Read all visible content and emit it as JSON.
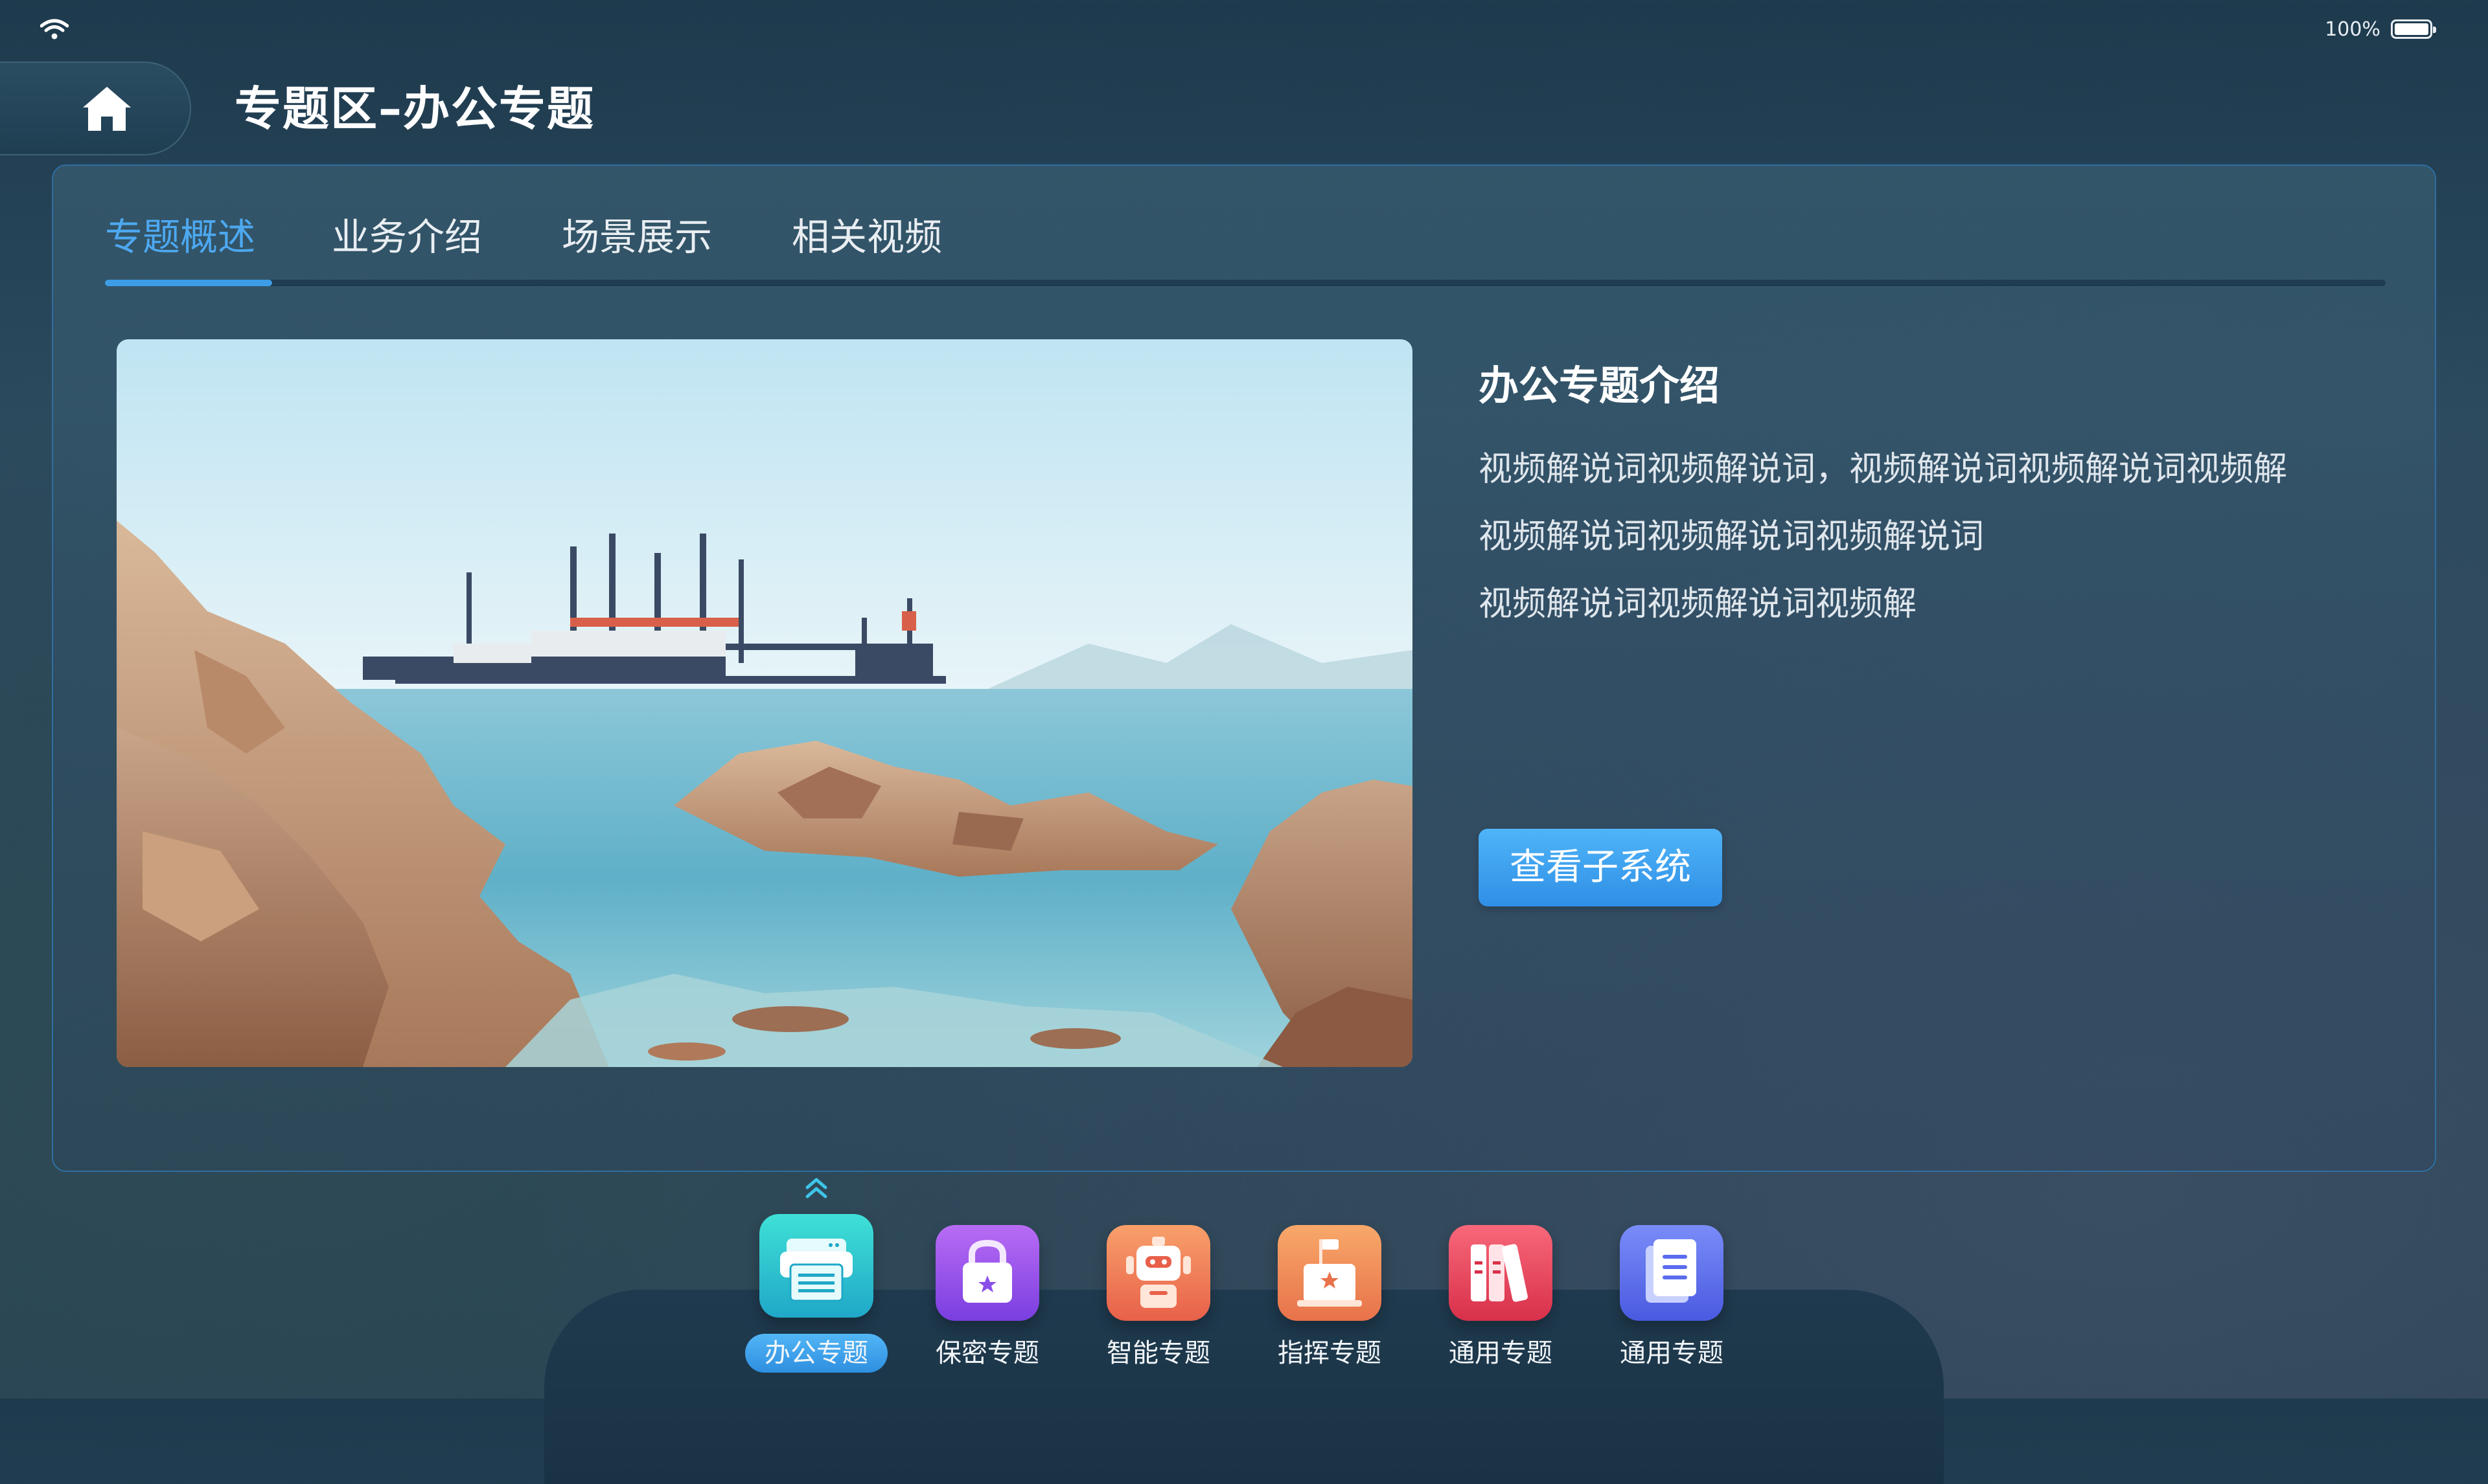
{
  "status_bar": {
    "battery": "100%",
    "wifi_icon": "wifi-icon",
    "battery_icon": "battery-icon"
  },
  "header": {
    "title": "专题区–办公专题",
    "home_icon": "home-icon"
  },
  "tabs": [
    {
      "label": "专题概述",
      "active": true
    },
    {
      "label": "业务介绍",
      "active": false
    },
    {
      "label": "场景展示",
      "active": false
    },
    {
      "label": "相关视频",
      "active": false
    }
  ],
  "intro": {
    "title": "办公专题介绍",
    "lines": [
      "视频解说词视频解说词，视频解说词视频解说词视频解",
      "视频解说词视频解说词视频解说词",
      "视频解说词视频解说词视频解"
    ],
    "button": "查看子系统"
  },
  "dock": [
    {
      "label": "办公专题",
      "icon": "printer-icon",
      "active": true,
      "color": "#2ec7d0"
    },
    {
      "label": "保密专题",
      "icon": "lock-icon",
      "active": false,
      "color": "#8a4ee8"
    },
    {
      "label": "智能专题",
      "icon": "robot-icon",
      "active": false,
      "color": "#ef7a56"
    },
    {
      "label": "指挥专题",
      "icon": "podium-icon",
      "active": false,
      "color": "#ef8a4e"
    },
    {
      "label": "通用专题",
      "icon": "books-icon",
      "active": false,
      "color": "#e8485c"
    },
    {
      "label": "通用专题",
      "icon": "document-icon",
      "active": false,
      "color": "#5a6cee"
    }
  ],
  "colors": {
    "accent": "#3d9de6",
    "panel_border": "#2f6ea0"
  }
}
